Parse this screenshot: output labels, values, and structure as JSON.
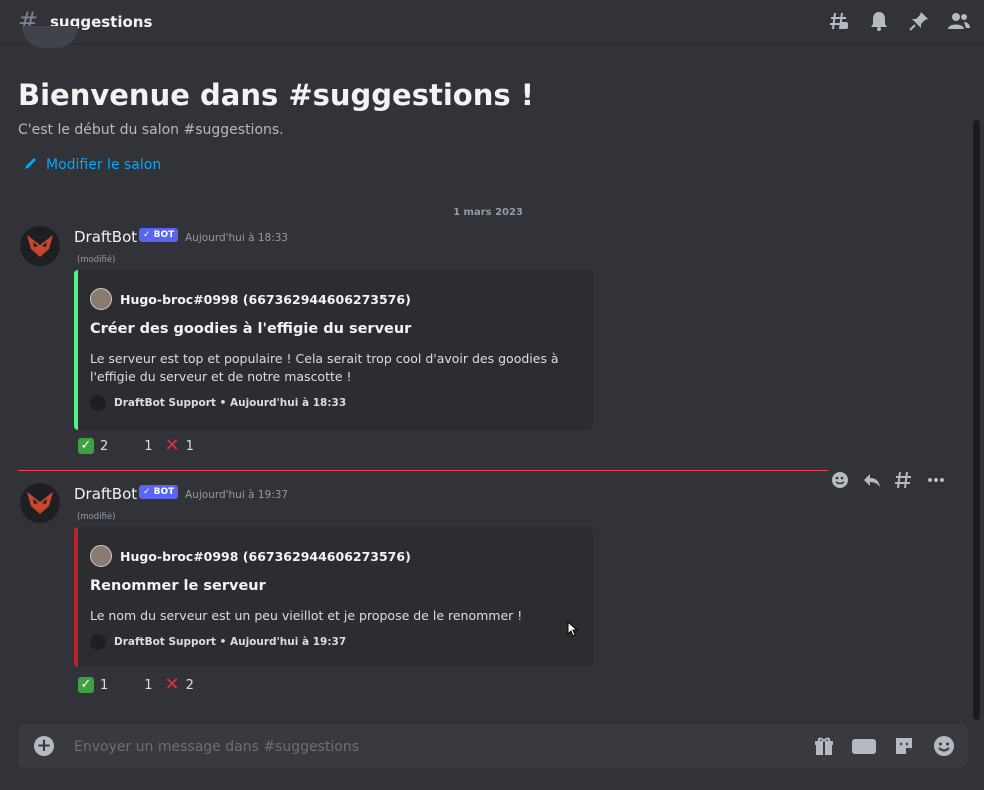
{
  "header": {
    "channel_name": "suggestions",
    "icons": [
      "threads-icon",
      "bell-icon",
      "pin-icon",
      "members-icon"
    ]
  },
  "welcome": {
    "title": "Bienvenue dans #suggestions !",
    "subtitle": "C'est le début du salon #suggestions.",
    "edit_link": "Modifier le salon"
  },
  "date_divider": "1 mars 2023",
  "messages": [
    {
      "author": "DraftBot",
      "badge": "✓ BOT",
      "timestamp": "Aujourd'hui à 18:33",
      "edited": "(modifié)",
      "embed": {
        "color": "#57f287",
        "author": "Hugo-broc#0998 (667362944606273576)",
        "title": "Créer des goodies à l'effigie du serveur",
        "description": "Le serveur est top et populaire ! Cela serait trop cool d'avoir des goodies à l'effigie du serveur et de notre mascotte !",
        "footer": "DraftBot Support • Aujourd'hui à 18:33"
      },
      "reactions": [
        {
          "icon": "check-icon",
          "count": "2"
        },
        {
          "icon": "neutral-icon",
          "count": "1"
        },
        {
          "icon": "cross-icon",
          "count": "1"
        }
      ]
    },
    {
      "author": "DraftBot",
      "badge": "✓ BOT",
      "timestamp": "Aujourd'hui à 19:37",
      "edited": "(modifié)",
      "embed": {
        "color": "#c0222b",
        "author": "Hugo-broc#0998 (667362944606273576)",
        "title": "Renommer le serveur",
        "description": "Le nom du serveur est un peu vieillot et je propose de le renommer !",
        "footer": "DraftBot Support • Aujourd'hui à 19:37"
      },
      "reactions": [
        {
          "icon": "check-icon",
          "count": "1"
        },
        {
          "icon": "neutral-icon",
          "count": "1"
        },
        {
          "icon": "cross-icon",
          "count": "2"
        }
      ]
    }
  ],
  "composer": {
    "placeholder": "Envoyer un message dans #suggestions"
  },
  "colors": {
    "background": "#313338",
    "accent_link": "#00a8fc",
    "bot_badge": "#5865f2",
    "new_messages_line": "#f23f43"
  }
}
